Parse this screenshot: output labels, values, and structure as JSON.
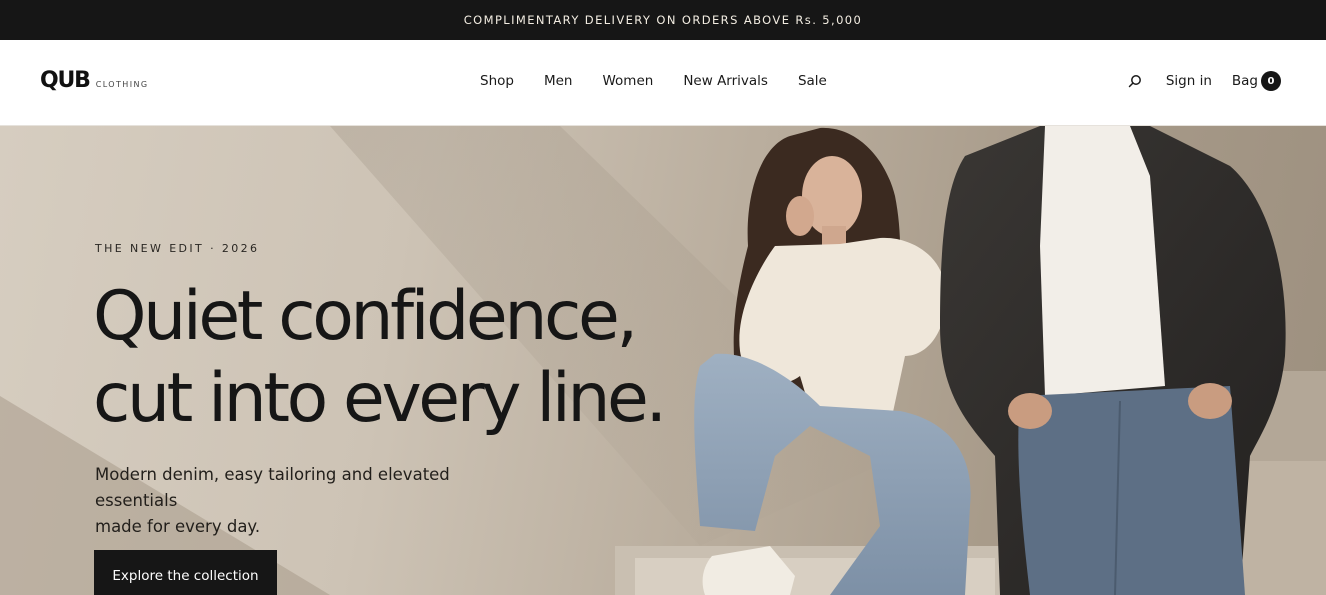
{
  "announcement": "COMPLIMENTARY DELIVERY ON ORDERS ABOVE Rs. 5,000",
  "brand": {
    "name": "QUB",
    "tagline": "CLOTHING"
  },
  "nav": {
    "items": [
      {
        "label": "Shop"
      },
      {
        "label": "Men"
      },
      {
        "label": "Women"
      },
      {
        "label": "New Arrivals"
      },
      {
        "label": "Sale"
      }
    ]
  },
  "utilities": {
    "search_icon": "search-icon",
    "signin_label": "Sign in",
    "bag_label": "Bag",
    "bag_count": "0"
  },
  "hero": {
    "eyebrow": "THE NEW EDIT · 2026",
    "headline_line1": "Quiet confidence,",
    "headline_line2": "cut into every line.",
    "subcopy_line1": "Modern denim, easy tailoring and elevated essentials",
    "subcopy_line2": "made for every day.",
    "cta_label": "Explore the collection"
  },
  "colors": {
    "announce_bg": "#161616",
    "hero_bg": "#cdc3b5",
    "cta_bg": "#161616",
    "accent_text": "#f3ede2"
  }
}
